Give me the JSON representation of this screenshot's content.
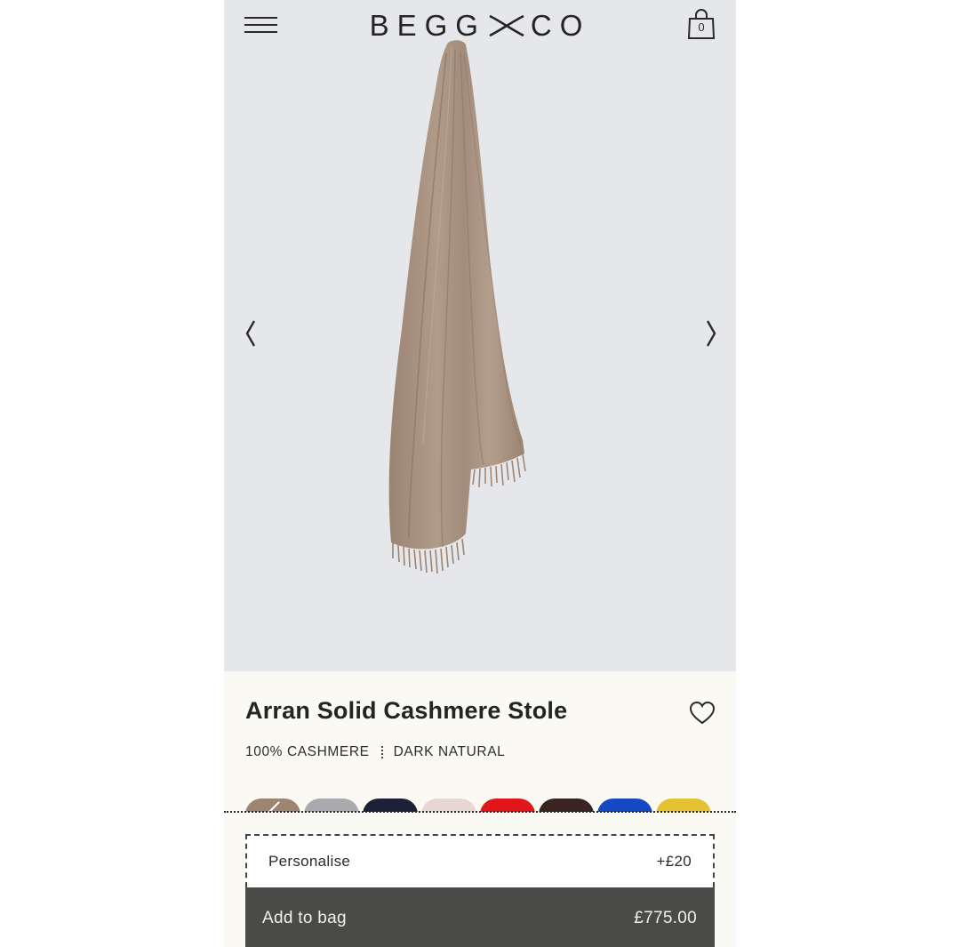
{
  "brand": {
    "logo_text_left": "BEGG",
    "logo_text_right": "CO"
  },
  "header": {
    "bag_count": "0"
  },
  "icons": {
    "menu": "hamburger-menu-icon",
    "bag": "shopping-bag-icon",
    "prev": "chevron-left-icon",
    "next": "chevron-right-icon",
    "wishlist": "heart-icon"
  },
  "product": {
    "title": "Arran Solid Cashmere Stole",
    "material": "100% CASHMERE",
    "colour": "DARK NATURAL",
    "image_alt": "scarf"
  },
  "swatches": [
    {
      "name": "dark natural",
      "color": "#9d8572",
      "selected": true
    },
    {
      "name": "grey",
      "color": "#a8aaad",
      "selected": false
    },
    {
      "name": "navy",
      "color": "#1b2238",
      "selected": false
    },
    {
      "name": "light pink",
      "color": "#e6d7d3",
      "selected": false
    },
    {
      "name": "red",
      "color": "#e1161a",
      "selected": false
    },
    {
      "name": "dark brown",
      "color": "#3a2420",
      "selected": false
    },
    {
      "name": "blue",
      "color": "#1548c4",
      "selected": false
    },
    {
      "name": "yellow",
      "color": "#e5c232",
      "selected": false
    }
  ],
  "personalise": {
    "label": "Personalise",
    "price": "+£20"
  },
  "add_to_bag": {
    "label": "Add to bag",
    "price": "£775.00"
  },
  "colors": {
    "hero_bg": "#e6e7eb",
    "panel_bg": "#faf9f4",
    "button_bg": "#4a4a48",
    "scarf": "#a8917f"
  }
}
